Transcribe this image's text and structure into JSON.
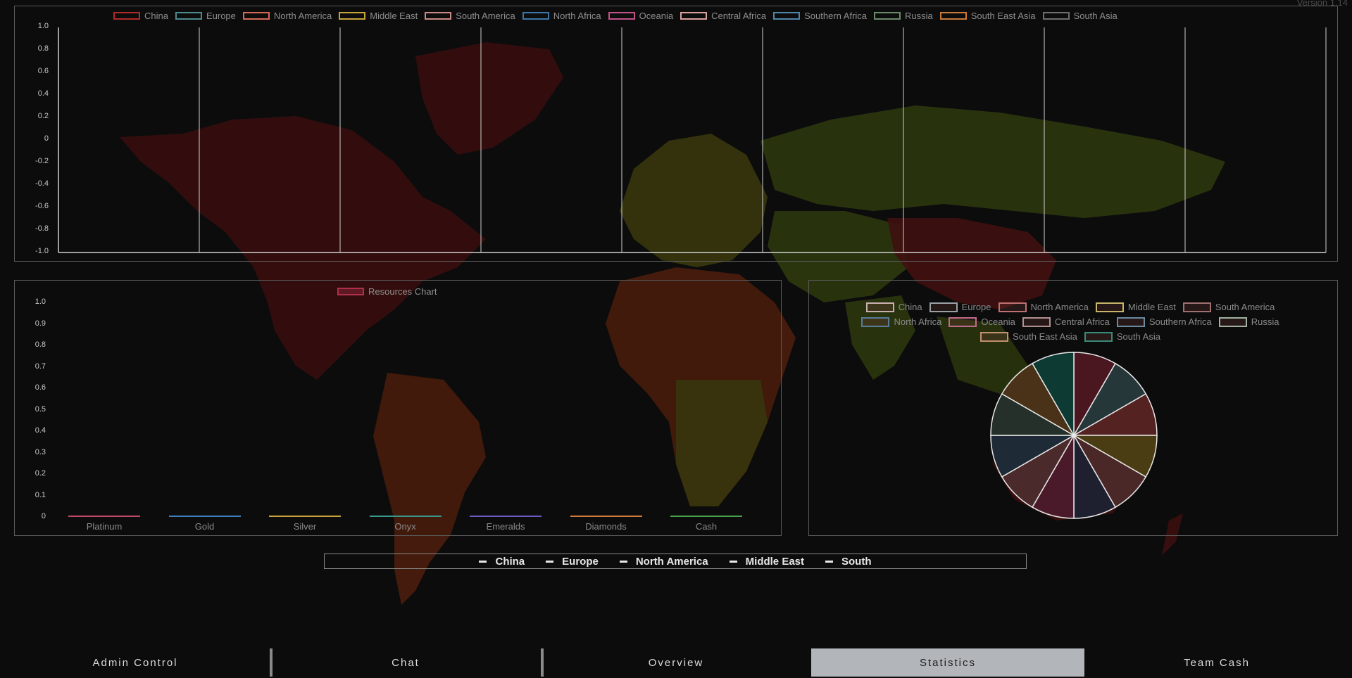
{
  "version": "Version 1.14",
  "top_chart": {
    "legend": [
      {
        "label": "China",
        "color": "#b02a2a"
      },
      {
        "label": "Europe",
        "color": "#4d8a8e"
      },
      {
        "label": "North America",
        "color": "#d46a55"
      },
      {
        "label": "Middle East",
        "color": "#c9a43a"
      },
      {
        "label": "South America",
        "color": "#c98a85"
      },
      {
        "label": "North Africa",
        "color": "#3d74a8"
      },
      {
        "label": "Oceania",
        "color": "#c0528a"
      },
      {
        "label": "Central Africa",
        "color": "#d9a0a0"
      },
      {
        "label": "Southern Africa",
        "color": "#4f86a8"
      },
      {
        "label": "Russia",
        "color": "#6a8a6a"
      },
      {
        "label": "South East Asia",
        "color": "#c97a3a"
      },
      {
        "label": "South Asia",
        "color": "#6e6e6e"
      }
    ],
    "y_ticks": [
      "1.0",
      "0.8",
      "0.6",
      "0.4",
      "0.2",
      "0",
      "-0.2",
      "-0.4",
      "-0.6",
      "-0.8",
      "-1.0"
    ]
  },
  "resources_chart": {
    "legend_label": "Resources Chart",
    "legend_color": "#b0304a",
    "y_ticks": [
      "1.0",
      "0.9",
      "0.8",
      "0.7",
      "0.6",
      "0.5",
      "0.4",
      "0.3",
      "0.2",
      "0.1",
      "0"
    ],
    "categories": [
      {
        "label": "Platinum",
        "color": "#c04a6a"
      },
      {
        "label": "Gold",
        "color": "#3f7fbf"
      },
      {
        "label": "Silver",
        "color": "#c9a43a"
      },
      {
        "label": "Onyx",
        "color": "#3a9a8a"
      },
      {
        "label": "Emeralds",
        "color": "#6a5ac0"
      },
      {
        "label": "Diamonds",
        "color": "#d07a3a"
      },
      {
        "label": "Cash",
        "color": "#4aa04a"
      }
    ]
  },
  "pie_chart": {
    "legend_rows": [
      [
        {
          "label": "China",
          "color": "#c9b0b0"
        },
        {
          "label": "Europe",
          "color": "#9aa0a4"
        },
        {
          "label": "North America",
          "color": "#c07070"
        },
        {
          "label": "Middle East",
          "color": "#c8b56a"
        },
        {
          "label": "South America",
          "color": "#a07070"
        }
      ],
      [
        {
          "label": "North Africa",
          "color": "#5a7a9a"
        },
        {
          "label": "Oceania",
          "color": "#c06a8a"
        },
        {
          "label": "Central Africa",
          "color": "#b09090"
        },
        {
          "label": "Southern Africa",
          "color": "#6a8aa0"
        },
        {
          "label": "Russia",
          "color": "#a0b0a0"
        }
      ],
      [
        {
          "label": "South East Asia",
          "color": "#c09070"
        },
        {
          "label": "South Asia",
          "color": "#3a8a7a"
        }
      ]
    ],
    "slices": [
      {
        "name": "China",
        "fill": "#4a1620"
      },
      {
        "name": "Europe",
        "fill": "#26373a"
      },
      {
        "name": "North America",
        "fill": "#552222"
      },
      {
        "name": "Middle East",
        "fill": "#4a3d14"
      },
      {
        "name": "South America",
        "fill": "#4a2828"
      },
      {
        "name": "North Africa",
        "fill": "#1e2030"
      },
      {
        "name": "Oceania",
        "fill": "#4a1a2a"
      },
      {
        "name": "Central Africa",
        "fill": "#4a2a2a"
      },
      {
        "name": "Southern Africa",
        "fill": "#1e2a36"
      },
      {
        "name": "Russia",
        "fill": "#26302a"
      },
      {
        "name": "South East Asia",
        "fill": "#4a3218"
      },
      {
        "name": "South Asia",
        "fill": "#0e3a34"
      }
    ]
  },
  "region_bar": [
    "China",
    "Europe",
    "North America",
    "Middle East",
    "South"
  ],
  "bottom_nav": [
    {
      "label": "Admin Control",
      "active": false
    },
    {
      "label": "Chat",
      "active": false
    },
    {
      "label": "Overview",
      "active": false
    },
    {
      "label": "Statistics",
      "active": true
    },
    {
      "label": "Team Cash",
      "active": false
    }
  ],
  "colors": {
    "map_red": "#4a1010",
    "map_orange": "#5a2210",
    "map_olive": "#3e3d0f",
    "map_green": "#2f3a10"
  }
}
